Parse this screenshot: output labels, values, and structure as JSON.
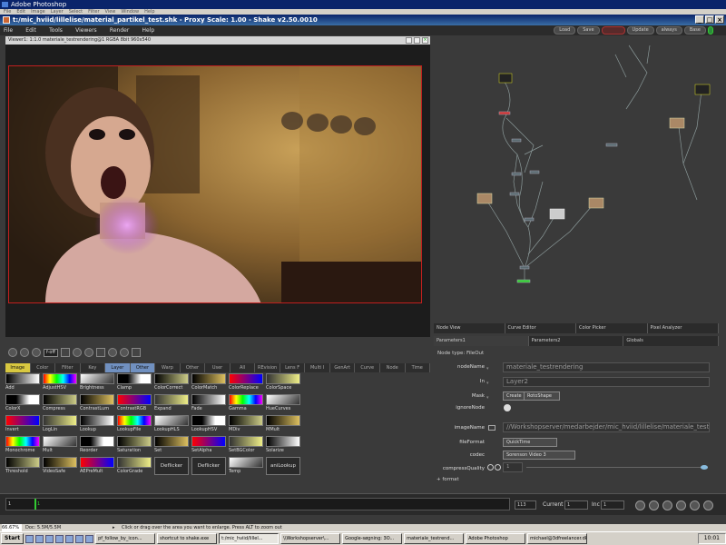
{
  "photoshop": {
    "title": "Adobe Photoshop",
    "menu": [
      "File",
      "Edit",
      "Image",
      "Layer",
      "Select",
      "Filter",
      "View",
      "Window",
      "Help"
    ]
  },
  "shake": {
    "title": "t:/mic_hviid/lillelise/material_partikel_test.shk - Proxy Scale: 1.00 - Shake v2.50.0010",
    "menu": [
      "File",
      "Edit",
      "Tools",
      "Viewers",
      "Render",
      "Help"
    ],
    "menu_right": [
      "Load",
      "Save",
      "",
      "Update",
      "always",
      "Base"
    ]
  },
  "viewer": {
    "header": "Viewer1: 1:1.0 materiale_testrendering@1 RGBA 8bit 960x540",
    "off_label": "f-off"
  },
  "tool_tabs": [
    "Image",
    "Color",
    "Filter",
    "Key",
    "Layer",
    "Other",
    "Warp",
    "Other",
    "User",
    "All",
    "REvision",
    "Lens F",
    "Multi I",
    "GenArt",
    "Curve",
    "Node",
    "Time"
  ],
  "tools": [
    [
      "Add",
      "AdjustHSV",
      "Brightness",
      "Clamp",
      "ColorCorrect",
      "ColorMatch",
      "ColorReplace",
      "ColorSpace"
    ],
    [
      "ColorX",
      "Compress",
      "ContrastLum",
      "ContrastRGB",
      "Expand",
      "Fade",
      "Gamma",
      "HueCurves"
    ],
    [
      "Invert",
      "LogLin",
      "Lookup",
      "LookupFile",
      "LookupHLS",
      "LookupHSV",
      "MDiv",
      "MMult"
    ],
    [
      "Monochrome",
      "Mult",
      "Reorder",
      "Saturation",
      "Set",
      "SetAlpha",
      "SetBGColor",
      "Solarize"
    ],
    [
      "Threshold",
      "VideoSafe",
      "AEPreMult",
      "ColorGrade",
      "Deflicker",
      "Deflicker",
      "Temp",
      "aniLookup"
    ]
  ],
  "node_view_tabs": [
    "Node View",
    "Curve Editor",
    "Color Picker",
    "Pixel Analyzer"
  ],
  "param_tabs": [
    "Parameters1",
    "Parameters2",
    "Globals"
  ],
  "params": {
    "node_type": "Node type: FileOut",
    "nodeName_label": "nodeName",
    "nodeName": "materiale_testrendering",
    "in_label": "In",
    "in_value": "Layer2",
    "mask_label": "Mask",
    "mask_create": "Create",
    "mask_value": "RotoShape",
    "ignoreNode_label": "ignoreNode",
    "imageName_label": "imageName",
    "imageName": "//Workshopserver/medarbejder/mic_hviid/lillelise/materiale_testre",
    "fileFormat_label": "fileFormat",
    "fileFormat": "QuickTime",
    "codec_label": "codec",
    "codec": "Sorenson Video 3",
    "compressQuality_label": "compressQuality",
    "compressQuality": "1",
    "format_label": "format"
  },
  "timeline": {
    "start": "1",
    "end": "113",
    "current_label": "Current",
    "current": "1",
    "inc_label": "Inc",
    "inc": "1",
    "tick_1": "1"
  },
  "status": {
    "zoom": "66.67%",
    "doc": "Doc: 5.5M/5.5M",
    "hint": "Click or drag over the area you want to enlarge. Press ALT to zoom out"
  },
  "taskbar": {
    "start": "Start",
    "tasks": [
      "pf_follow_by_icon...",
      "shortcut to shake.exe",
      "t:/mic_hviid/lillel...",
      "\\\\Workshopserver\\...",
      "Google-søgning: 3O...",
      "materiale_testrend...",
      "Adobe Photoshop",
      "michael@3dfreelancer.dk"
    ],
    "clock": "10:01"
  }
}
